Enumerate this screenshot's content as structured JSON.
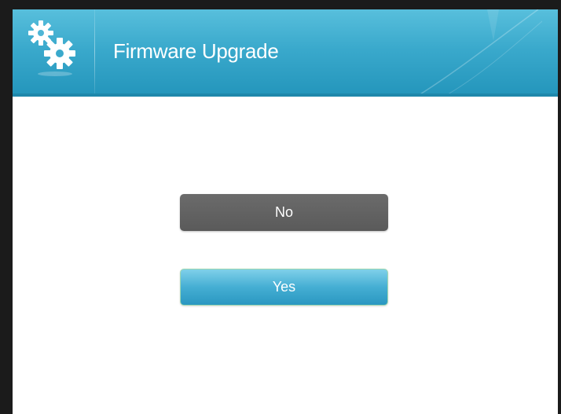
{
  "dialog": {
    "title": "Firmware Upgrade",
    "header_icon": "gears-icon"
  },
  "buttons": {
    "no_label": "No",
    "yes_label": "Yes"
  },
  "colors": {
    "header": "#3aa9cc",
    "no_button": "#5f5f5f",
    "yes_button": "#45aed3",
    "frame": "#1b1b1b"
  }
}
